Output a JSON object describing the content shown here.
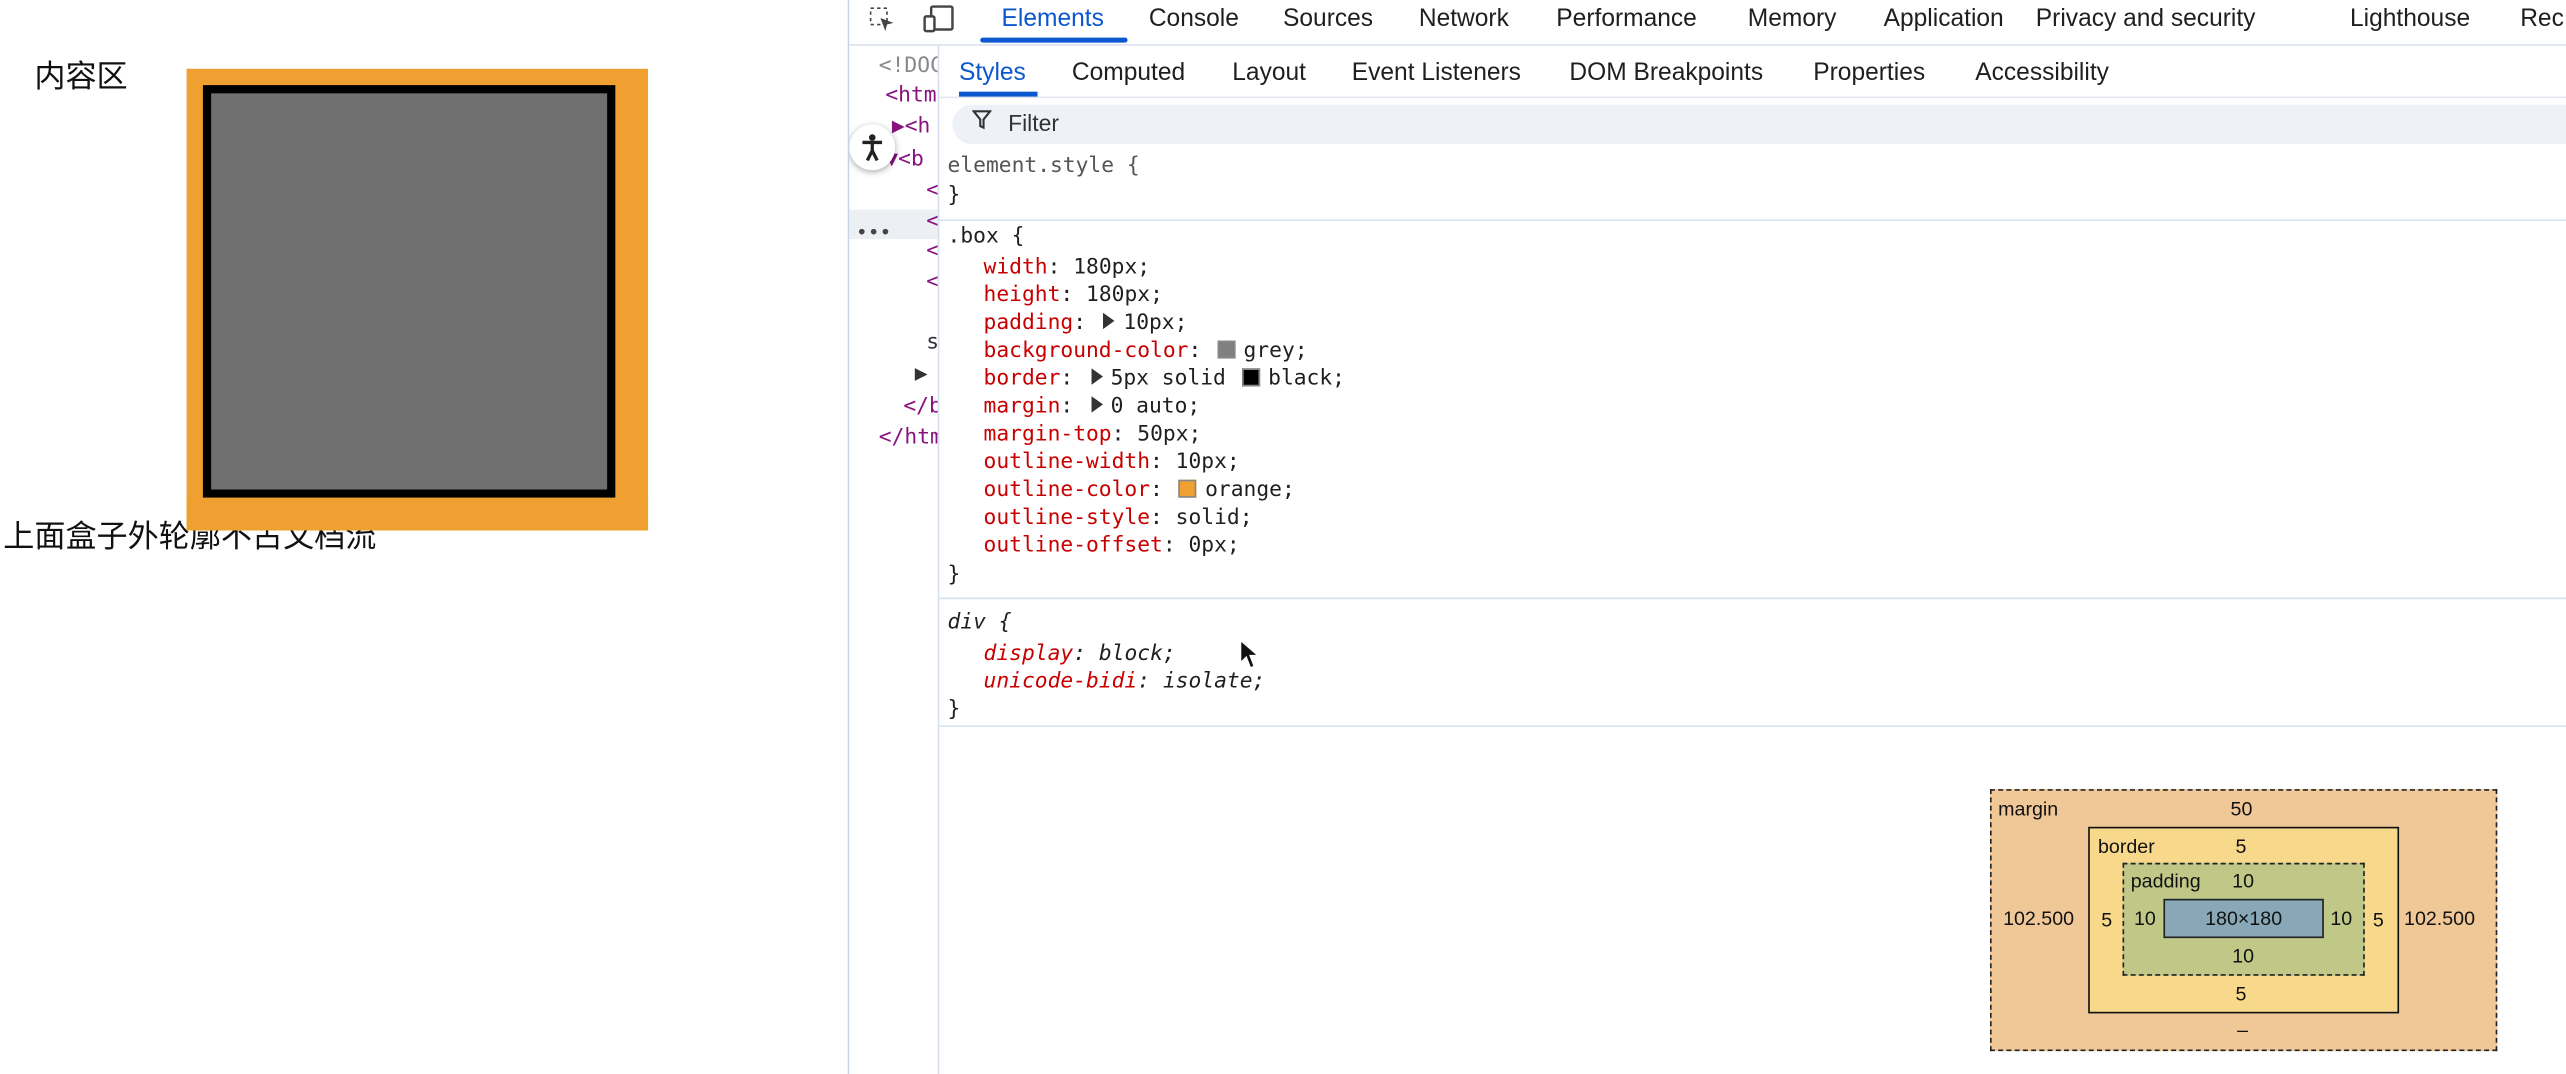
{
  "preview": {
    "box_text": "内容区",
    "flow_text": "上面盒子外轮廓不占文档流",
    "colors": {
      "outline": "#f0a030",
      "border": "#000000",
      "background": "#707070"
    }
  },
  "devtools": {
    "tools_icons": [
      "inspect-element-icon",
      "device-toolbar-icon"
    ],
    "tabs": [
      "Elements",
      "Console",
      "Sources",
      "Network",
      "Performance",
      "Memory",
      "Application",
      "Privacy and security",
      "Lighthouse",
      "Rec"
    ],
    "active_tab": "Elements",
    "dom_lines": [
      "<!DOC",
      "<htm",
      "▶<h",
      "▼<b",
      "<",
      "<",
      "<",
      "<",
      "s",
      "▶",
      "</b",
      "</htm"
    ],
    "subtabs": [
      "Styles",
      "Computed",
      "Layout",
      "Event Listeners",
      "DOM Breakpoints",
      "Properties",
      "Accessibility"
    ],
    "active_subtab": "Styles",
    "filter_placeholder": "Filter",
    "element_style": {
      "selector": "element.style {",
      "close": "}"
    },
    "box_rule": {
      "selector": ".box {",
      "declarations": [
        {
          "prop": "width",
          "value": "180px;"
        },
        {
          "prop": "height",
          "value": "180px;"
        },
        {
          "prop": "padding",
          "value": "10px;"
        },
        {
          "prop": "background-color",
          "value": "grey;"
        },
        {
          "prop": "border",
          "value": "5px solid",
          "value2": "black;"
        },
        {
          "prop": "margin",
          "value": "0 auto;"
        },
        {
          "prop": "margin-top",
          "value": "50px;"
        },
        {
          "prop": "outline-width",
          "value": "10px;"
        },
        {
          "prop": "outline-color",
          "value": "orange;"
        },
        {
          "prop": "outline-style",
          "value": "solid;"
        },
        {
          "prop": "outline-offset",
          "value": "0px;"
        }
      ],
      "close": "}"
    },
    "div_rule": {
      "selector": "div {",
      "declarations": [
        {
          "prop": "display",
          "value": "block;"
        },
        {
          "prop": "unicode-bidi",
          "value": "isolate;"
        }
      ],
      "close": "}"
    },
    "box_model": {
      "margin_label": "margin",
      "margin_top": "50",
      "margin_left": "102.500",
      "margin_right": "102.500",
      "margin_bottom": "–",
      "border_label": "border",
      "border_top": "5",
      "border_left": "5",
      "border_right": "5",
      "border_bottom": "5",
      "padding_label": "padding",
      "padding_top": "10",
      "padding_left": "10",
      "padding_right": "10",
      "padding_bottom": "10",
      "content": "180×180"
    }
  }
}
